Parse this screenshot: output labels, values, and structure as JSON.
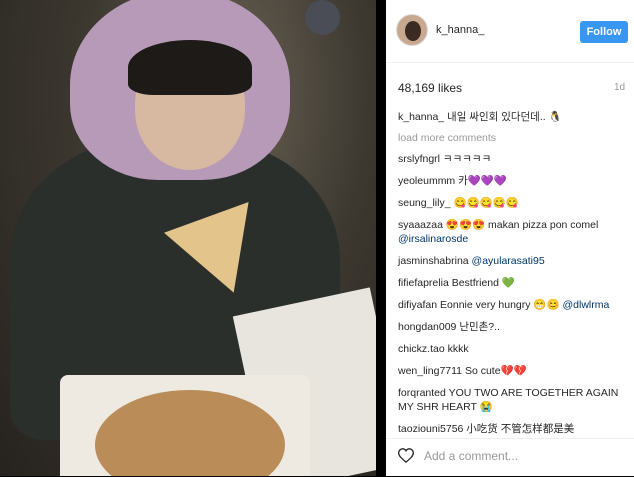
{
  "post": {
    "username": "k_hanna_",
    "follow_label": "Follow",
    "likes": "48,169 likes",
    "time": "1d"
  },
  "caption": {
    "username": "k_hanna_",
    "text": " 내일 싸인회 있다던데.. 🐧"
  },
  "load_more": "load more comments",
  "comments": [
    {
      "user": "srslyfngrl",
      "text": " ㅋㅋㅋㅋㅋ",
      "mention": ""
    },
    {
      "user": "yeoleummm",
      "text": " 카💜💜💜",
      "mention": ""
    },
    {
      "user": "seung_lily_",
      "text": " 😋😋😋😋😋",
      "mention": ""
    },
    {
      "user": "syaaazaa",
      "text": " 😍😍😍 makan pizza pon comel ",
      "mention": "@irsalinarosde"
    },
    {
      "user": "jasminshabrina",
      "text": " ",
      "mention": "@ayularasati95"
    },
    {
      "user": "fifiefaprelia",
      "text": " Bestfriend 💚",
      "mention": ""
    },
    {
      "user": "difiyafan",
      "text": " Eonnie very hungry 😁😊 ",
      "mention": "@dlwlrma"
    },
    {
      "user": "hongdan009",
      "text": " 난민촌?..",
      "mention": ""
    },
    {
      "user": "chickz.tao",
      "text": " kkkk",
      "mention": ""
    },
    {
      "user": "wen_ling7711",
      "text": " So cute💔💔",
      "mention": ""
    },
    {
      "user": "forqranted",
      "text": " YOU TWO ARE TOGETHER AGAIN MY SHR HEART 😭",
      "mention": ""
    },
    {
      "user": "taoziouni5756",
      "text": " 小吃货 不管怎样都是美",
      "mention": ""
    }
  ],
  "add_comment": {
    "placeholder": "Add a comment...",
    "icon": "heart-outline-icon"
  }
}
